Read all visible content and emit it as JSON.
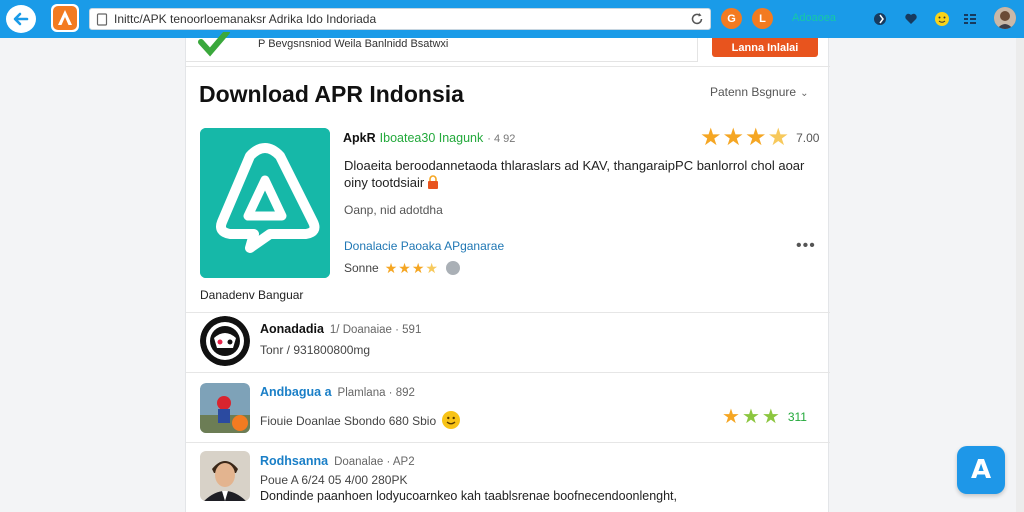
{
  "browser": {
    "url": "Inittc/APK tenoorloemanaksr Adrika Ido Indoriada",
    "orange_button_1": "G",
    "orange_button_2": "L",
    "toolbar_label": "Adoaoea",
    "colors": {
      "toolbar": "#1a9be8",
      "accent_orange": "#f37b21",
      "label_teal": "#16c9a6"
    }
  },
  "banner": {
    "text": "P Bevgsnsniod Weila  Banlnidd Bsatwxi",
    "install_button": "Lanna Inlalai"
  },
  "page": {
    "title": "Download APR Indonsia",
    "sort_label": "Patenn Bsgnure"
  },
  "featured_app": {
    "name": "ApkR",
    "tagline": "Iboatea30 Inagunk",
    "version": "· 4 92",
    "rating_value": "7.00",
    "rating_stars": 3.5,
    "description": "Dloaeita beroodannetaoda thlaraslars ad KAV, thangaraipPC banlorrol chol aoar oiny tootdsiair",
    "meta": "Oanp, nid adotdha",
    "related_link": "Donalacie Paoaka APganarae",
    "small_rating_label": "Sonne",
    "small_rating_stars": 3.5,
    "caption": "Danadenv Banguar",
    "icon_color": "#16b8a8"
  },
  "rows": [
    {
      "title": "Aonadadia",
      "subtitle": "1/ Doanaiae · 591",
      "line": "Tonr / 931800800mg"
    },
    {
      "title": "Andbagua a",
      "subtitle": "Plamlana · 892",
      "line": "Fiouie Doanlae Sbondo 680 Sbio",
      "rating_value": "311",
      "rating_stars": 3
    },
    {
      "title": "Rodhsanna",
      "subtitle": "Doanalae · AP2",
      "line": "Poue A 6/24 05 4/00 280PK",
      "description": "Dondinde paanhoen lodyucoarnkeo kah taablsrenae boofnecendoonlenght,"
    }
  ],
  "fab_label": "A"
}
